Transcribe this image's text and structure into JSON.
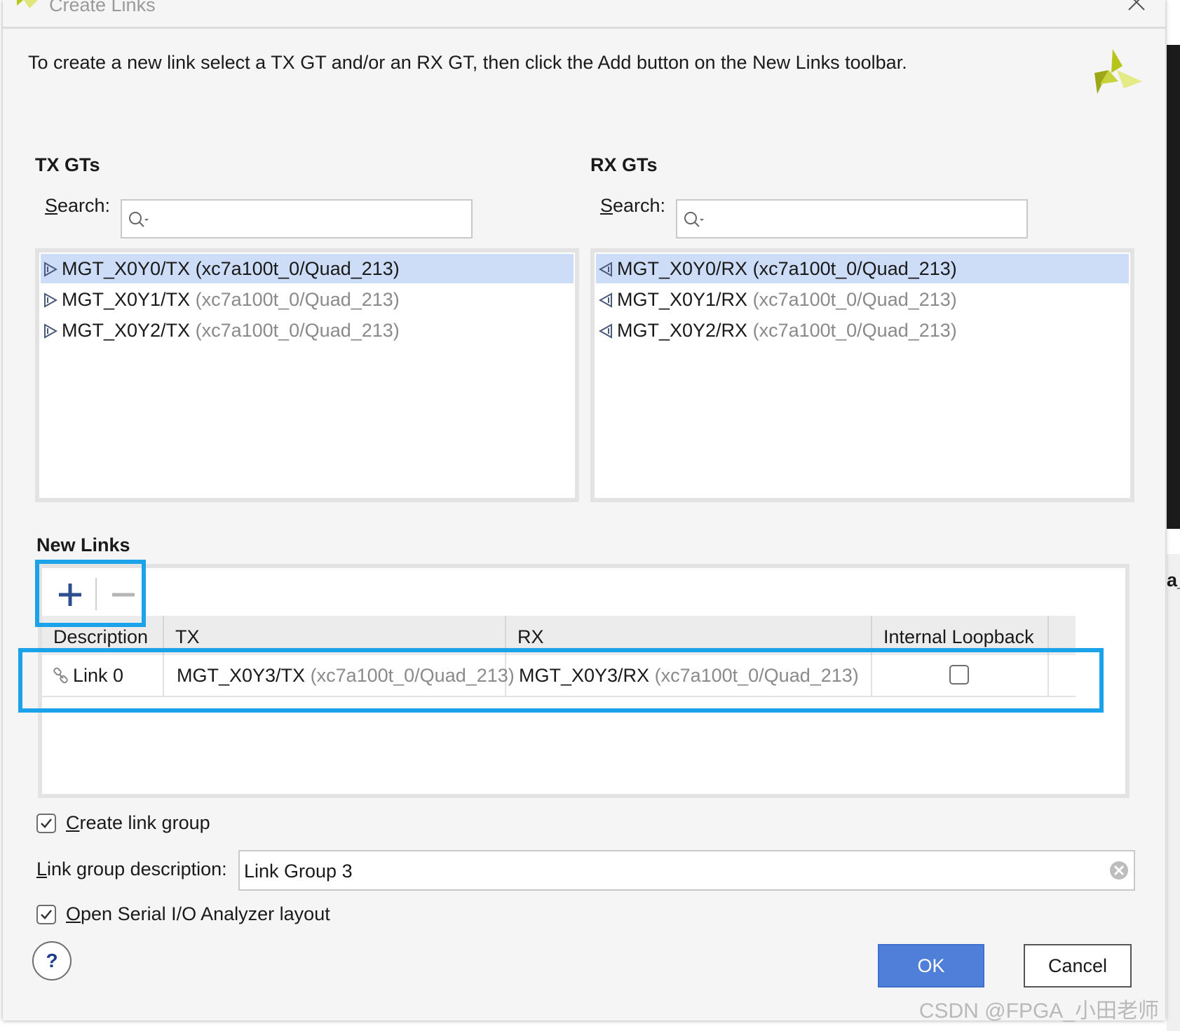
{
  "window": {
    "title": "Create Links",
    "instructions": "To create a new link select a TX GT and/or an RX GT, then click the Add button on the New Links toolbar."
  },
  "tx_gts": {
    "heading": "TX GTs",
    "search_label": "Search:",
    "search_value": "",
    "items": [
      {
        "name": "MGT_X0Y0/TX",
        "path": "(xc7a100t_0/Quad_213)",
        "selected": true
      },
      {
        "name": "MGT_X0Y1/TX",
        "path": "(xc7a100t_0/Quad_213)",
        "selected": false
      },
      {
        "name": "MGT_X0Y2/TX",
        "path": "(xc7a100t_0/Quad_213)",
        "selected": false
      }
    ]
  },
  "rx_gts": {
    "heading": "RX GTs",
    "search_label": "Search:",
    "search_value": "",
    "items": [
      {
        "name": "MGT_X0Y0/RX",
        "path": "(xc7a100t_0/Quad_213)",
        "selected": true
      },
      {
        "name": "MGT_X0Y1/RX",
        "path": "(xc7a100t_0/Quad_213)",
        "selected": false
      },
      {
        "name": "MGT_X0Y2/RX",
        "path": "(xc7a100t_0/Quad_213)",
        "selected": false
      }
    ]
  },
  "new_links": {
    "heading": "New Links",
    "columns": [
      "Description",
      "TX",
      "RX",
      "Internal Loopback"
    ],
    "rows": [
      {
        "description": "Link 0",
        "tx_name": "MGT_X0Y3/TX",
        "tx_path": "(xc7a100t_0/Quad_213)",
        "rx_name": "MGT_X0Y3/RX",
        "rx_path": "(xc7a100t_0/Quad_213)",
        "internal_loopback": false
      }
    ]
  },
  "options": {
    "create_link_group_label": "Create link group",
    "create_link_group_checked": true,
    "link_group_description_label": "Link group description:",
    "link_group_description_value": "Link Group 3",
    "open_layout_label": "Open Serial I/O Analyzer layout",
    "open_layout_checked": true
  },
  "buttons": {
    "help": "?",
    "ok": "OK",
    "cancel": "Cancel"
  },
  "background": {
    "fragment": "a_"
  },
  "watermark": "CSDN @FPGA_小田老师",
  "colors": {
    "selection": "#cddcf7",
    "highlight_box": "#1aa3e8",
    "ok_button": "#4f7fd8",
    "logo_green": "#b7c41a"
  }
}
